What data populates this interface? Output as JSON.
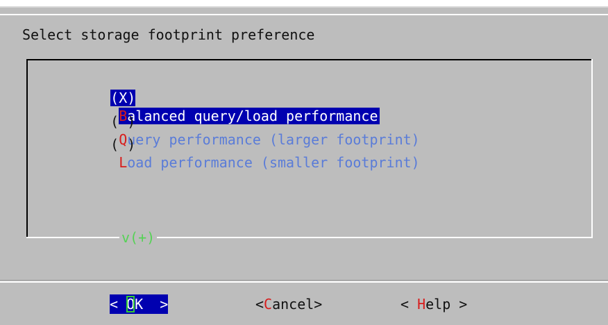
{
  "dialog": {
    "prompt": "Select storage footprint preference"
  },
  "options": [
    {
      "mark": "(X)",
      "hotkey": "B",
      "rest": "alanced query/load performance",
      "selected": true
    },
    {
      "mark": "( )",
      "hotkey": "Q",
      "rest": "uery performance (larger footprint)",
      "selected": false
    },
    {
      "mark": "( )",
      "hotkey": "L",
      "rest": "oad performance (smaller footprint)",
      "selected": false
    }
  ],
  "scroll_indicator": "v(+)",
  "buttons": {
    "ok": {
      "left": "< ",
      "hotkey": "O",
      "rest": "K  >"
    },
    "cancel": {
      "left": "<",
      "hotkey": "C",
      "rest": "ancel>"
    },
    "help": {
      "left": "< ",
      "hotkey": "H",
      "rest": "elp >"
    }
  },
  "colors": {
    "background": "#bdbdbd",
    "selection": "#0000b0",
    "hotkey": "#d81c1c",
    "item_text": "#5a7cd8",
    "scroll_indicator": "#55d255",
    "cursor": "#33cc33"
  }
}
